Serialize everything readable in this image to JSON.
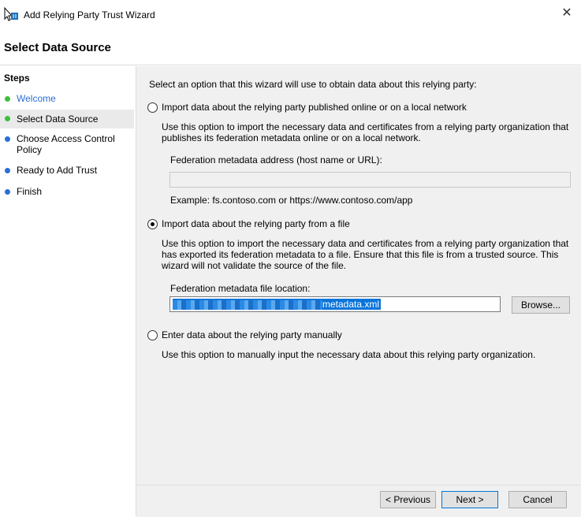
{
  "window": {
    "title": "Add Relying Party Trust Wizard",
    "close_glyph": "✕"
  },
  "header": {
    "title": "Select Data Source"
  },
  "steps": {
    "heading": "Steps",
    "items": [
      {
        "label": "Welcome",
        "status": "complete",
        "color": "#2b6fd6"
      },
      {
        "label": "Select Data Source",
        "status": "current"
      },
      {
        "label": "Choose Access Control Policy",
        "status": "pending"
      },
      {
        "label": "Ready to Add Trust",
        "status": "pending"
      },
      {
        "label": "Finish",
        "status": "pending"
      }
    ]
  },
  "main": {
    "intro": "Select an option that this wizard will use to obtain data about this relying party:",
    "option1": {
      "label": "Import data about the relying party published online or on a local network",
      "description": "Use this option to import the necessary data and certificates from a relying party organization that publishes its federation metadata online or on a local network.",
      "field_label": "Federation metadata address (host name or URL):",
      "field_value": "",
      "example": "Example: fs.contoso.com or https://www.contoso.com/app",
      "selected": false
    },
    "option2": {
      "label": "Import data about the relying party from a file",
      "description": "Use this option to import the necessary data and certificates from a relying party organization that has exported its federation metadata to a file. Ensure that this file is from a trusted source.  This wizard will not validate the source of the file.",
      "field_label": "Federation metadata file location:",
      "field_value_visible": "metadata.xml",
      "browse_label": "Browse...",
      "selected": true
    },
    "option3": {
      "label": "Enter data about the relying party manually",
      "description": "Use this option to manually input the necessary data about this relying party organization.",
      "selected": false
    }
  },
  "footer": {
    "previous_label": "< Previous",
    "next_label": "Next >",
    "cancel_label": "Cancel"
  }
}
